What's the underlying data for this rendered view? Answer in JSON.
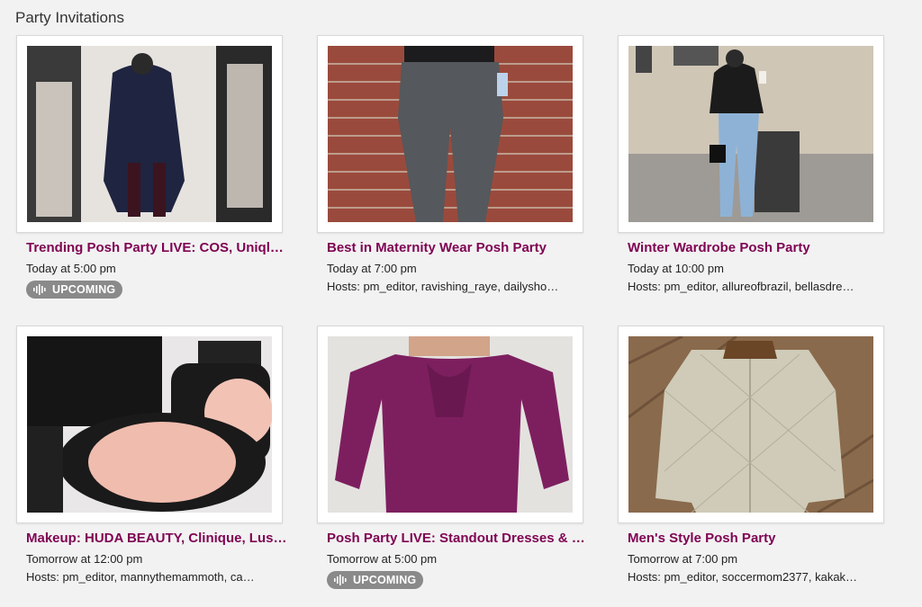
{
  "section": {
    "title": "Party Invitations"
  },
  "cards": [
    {
      "title": "Trending Posh Party LIVE: COS, Uniqlo…",
      "time": "Today at 5:00 pm",
      "badge": "UPCOMING",
      "hosts": ""
    },
    {
      "title": "Best in Maternity Wear Posh Party",
      "time": "Today at 7:00 pm",
      "badge": "",
      "hosts": "Hosts: pm_editor, ravishing_raye, dailysho…"
    },
    {
      "title": "Winter Wardrobe Posh Party",
      "time": "Today at 10:00 pm",
      "badge": "",
      "hosts": "Hosts: pm_editor, allureofbrazil, bellasdre…"
    },
    {
      "title": "Makeup: HUDA BEAUTY, Clinique, Lus…",
      "time": "Tomorrow at 12:00 pm",
      "badge": "",
      "hosts": "Hosts: pm_editor, mannythemammoth, ca…"
    },
    {
      "title": "Posh Party LIVE: Standout Dresses & …",
      "time": "Tomorrow at 5:00 pm",
      "badge": "UPCOMING",
      "hosts": ""
    },
    {
      "title": "Men's Style Posh Party",
      "time": "Tomorrow at 7:00 pm",
      "badge": "",
      "hosts": "Hosts: pm_editor, soccermom2377, kakak…"
    }
  ],
  "colors": {
    "title": "#7f0353",
    "badge_bg": "#8a8a8a"
  }
}
